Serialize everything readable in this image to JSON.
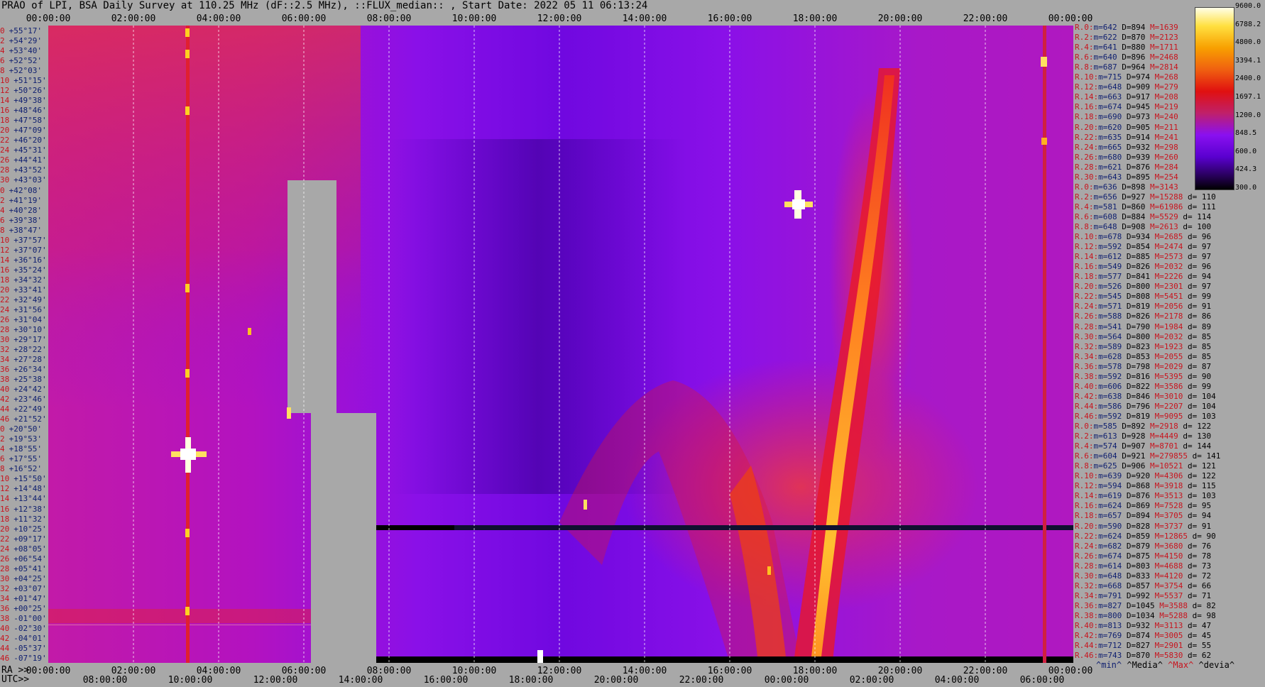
{
  "title": "PRAO of LPI, BSA Daily Survey at 110.25 MHz (dF::2.5 MHz), ::FLUX_median:: , Start Date: 2022 05 11 06:13:24",
  "chart_data": {
    "type": "heatmap",
    "x_ticks_top": [
      "00:00:00",
      "02:00:00",
      "04:00:00",
      "06:00:00",
      "08:00:00",
      "10:00:00",
      "12:00:00",
      "14:00:00",
      "16:00:00",
      "18:00:00",
      "20:00:00",
      "22:00:00",
      "00:00:00"
    ],
    "x_ticks_ra": [
      "00:00:00",
      "02:00:00",
      "04:00:00",
      "06:00:00",
      "08:00:00",
      "10:00:00",
      "12:00:00",
      "14:00:00",
      "16:00:00",
      "18:00:00",
      "20:00:00",
      "22:00:00",
      "00:00:00"
    ],
    "x_ticks_utc": [
      "08:00:00",
      "10:00:00",
      "12:00:00",
      "14:00:00",
      "16:00:00",
      "18:00:00",
      "20:00:00",
      "22:00:00",
      "00:00:00",
      "02:00:00",
      "04:00:00",
      "06:00:00"
    ],
    "ra_prefix": "RA >>",
    "utc_prefix": "UTC>>",
    "y_labels": [
      {
        "beam": "0",
        "dec": "+55°17'"
      },
      {
        "beam": "2",
        "dec": "+54°29'"
      },
      {
        "beam": "4",
        "dec": "+53°40'"
      },
      {
        "beam": "6",
        "dec": "+52°52'"
      },
      {
        "beam": "8",
        "dec": "+52°03'"
      },
      {
        "beam": "10",
        "dec": "+51°15'"
      },
      {
        "beam": "12",
        "dec": "+50°26'"
      },
      {
        "beam": "14",
        "dec": "+49°38'"
      },
      {
        "beam": "16",
        "dec": "+48°46'"
      },
      {
        "beam": "18",
        "dec": "+47°58'"
      },
      {
        "beam": "20",
        "dec": "+47°09'"
      },
      {
        "beam": "22",
        "dec": "+46°20'"
      },
      {
        "beam": "24",
        "dec": "+45°31'"
      },
      {
        "beam": "26",
        "dec": "+44°41'"
      },
      {
        "beam": "28",
        "dec": "+43°52'"
      },
      {
        "beam": "30",
        "dec": "+43°03'"
      },
      {
        "beam": "0",
        "dec": "+42°08'"
      },
      {
        "beam": "2",
        "dec": "+41°19'"
      },
      {
        "beam": "4",
        "dec": "+40°28'"
      },
      {
        "beam": "6",
        "dec": "+39°38'"
      },
      {
        "beam": "8",
        "dec": "+38°47'"
      },
      {
        "beam": "10",
        "dec": "+37°57'"
      },
      {
        "beam": "12",
        "dec": "+37°07'"
      },
      {
        "beam": "14",
        "dec": "+36°16'"
      },
      {
        "beam": "16",
        "dec": "+35°24'"
      },
      {
        "beam": "18",
        "dec": "+34°32'"
      },
      {
        "beam": "20",
        "dec": "+33°41'"
      },
      {
        "beam": "22",
        "dec": "+32°49'"
      },
      {
        "beam": "24",
        "dec": "+31°56'"
      },
      {
        "beam": "26",
        "dec": "+31°04'"
      },
      {
        "beam": "28",
        "dec": "+30°10'"
      },
      {
        "beam": "30",
        "dec": "+29°17'"
      },
      {
        "beam": "32",
        "dec": "+28°22'"
      },
      {
        "beam": "34",
        "dec": "+27°28'"
      },
      {
        "beam": "36",
        "dec": "+26°34'"
      },
      {
        "beam": "38",
        "dec": "+25°38'"
      },
      {
        "beam": "40",
        "dec": "+24°42'"
      },
      {
        "beam": "42",
        "dec": "+23°46'"
      },
      {
        "beam": "44",
        "dec": "+22°49'"
      },
      {
        "beam": "46",
        "dec": "+21°52'"
      },
      {
        "beam": "0",
        "dec": "+20°50'"
      },
      {
        "beam": "2",
        "dec": "+19°53'"
      },
      {
        "beam": "4",
        "dec": "+18°55'"
      },
      {
        "beam": "6",
        "dec": "+17°55'"
      },
      {
        "beam": "8",
        "dec": "+16°52'"
      },
      {
        "beam": "10",
        "dec": "+15°50'"
      },
      {
        "beam": "12",
        "dec": "+14°48'"
      },
      {
        "beam": "14",
        "dec": "+13°44'"
      },
      {
        "beam": "16",
        "dec": "+12°38'"
      },
      {
        "beam": "18",
        "dec": "+11°32'"
      },
      {
        "beam": "20",
        "dec": "+10°25'"
      },
      {
        "beam": "22",
        "dec": "+09°17'"
      },
      {
        "beam": "24",
        "dec": "+08°05'"
      },
      {
        "beam": "26",
        "dec": "+06°54'"
      },
      {
        "beam": "28",
        "dec": "+05°41'"
      },
      {
        "beam": "30",
        "dec": "+04°25'"
      },
      {
        "beam": "32",
        "dec": "+03°07'"
      },
      {
        "beam": "34",
        "dec": "+01°47'"
      },
      {
        "beam": "36",
        "dec": "+00°25'"
      },
      {
        "beam": "38",
        "dec": "-01°00'"
      },
      {
        "beam": "40",
        "dec": "-02°30'"
      },
      {
        "beam": "42",
        "dec": "-04°01'"
      },
      {
        "beam": "44",
        "dec": "-05°37'"
      },
      {
        "beam": "46",
        "dec": "-07°19'"
      }
    ],
    "colorbar": {
      "ticks": [
        "9600.0",
        "6788.2",
        "4800.0",
        "3394.1",
        "2400.0",
        "1697.1",
        "1200.0",
        "848.5",
        "600.0",
        "424.3",
        "300.0"
      ],
      "colors": [
        "#000000",
        "#2a0060",
        "#5a00d0",
        "#8a10f0",
        "#c0206a",
        "#e01010",
        "#f06010",
        "#f8a000",
        "#ffe040",
        "#ffffe8"
      ]
    },
    "stats": [
      {
        "label": "R.0:",
        "min": "642",
        "median": "894",
        "max": "1639",
        "dev": ""
      },
      {
        "label": "R.2:",
        "min": "622",
        "median": "870",
        "max": "2123",
        "dev": ""
      },
      {
        "label": "R.4:",
        "min": "641",
        "median": "880",
        "max": "1711",
        "dev": ""
      },
      {
        "label": "R.6:",
        "min": "640",
        "median": "896",
        "max": "2468",
        "dev": ""
      },
      {
        "label": "R.8:",
        "min": "687",
        "median": "964",
        "max": "2814",
        "dev": ""
      },
      {
        "label": "R.10:",
        "min": "715",
        "median": "974",
        "max": "268",
        "dev": ""
      },
      {
        "label": "R.12:",
        "min": "648",
        "median": "909",
        "max": "279",
        "dev": ""
      },
      {
        "label": "R.14:",
        "min": "663",
        "median": "917",
        "max": "208",
        "dev": ""
      },
      {
        "label": "R.16:",
        "min": "674",
        "median": "945",
        "max": "219",
        "dev": ""
      },
      {
        "label": "R.18:",
        "min": "690",
        "median": "973",
        "max": "240",
        "dev": ""
      },
      {
        "label": "R.20:",
        "min": "620",
        "median": "905",
        "max": "211",
        "dev": ""
      },
      {
        "label": "R.22:",
        "min": "635",
        "median": "914",
        "max": "241",
        "dev": ""
      },
      {
        "label": "R.24:",
        "min": "665",
        "median": "932",
        "max": "298",
        "dev": ""
      },
      {
        "label": "R.26:",
        "min": "680",
        "median": "939",
        "max": "260",
        "dev": ""
      },
      {
        "label": "R.28:",
        "min": "621",
        "median": "876",
        "max": "284",
        "dev": ""
      },
      {
        "label": "R.30:",
        "min": "643",
        "median": "895",
        "max": "254",
        "dev": ""
      },
      {
        "label": "R.0:",
        "min": "636",
        "median": "898",
        "max": "3143",
        "dev": ""
      },
      {
        "label": "R.2:",
        "min": "656",
        "median": "927",
        "max": "15288",
        "dev": "110"
      },
      {
        "label": "R.4:",
        "min": "581",
        "median": "860",
        "max": "61986",
        "dev": "111"
      },
      {
        "label": "R.6:",
        "min": "608",
        "median": "884",
        "max": "5529",
        "dev": "114"
      },
      {
        "label": "R.8:",
        "min": "648",
        "median": "908",
        "max": "2613",
        "dev": "100"
      },
      {
        "label": "R.10:",
        "min": "678",
        "median": "934",
        "max": "2685",
        "dev": "96"
      },
      {
        "label": "R.12:",
        "min": "592",
        "median": "854",
        "max": "2474",
        "dev": "97"
      },
      {
        "label": "R.14:",
        "min": "612",
        "median": "885",
        "max": "2573",
        "dev": "97"
      },
      {
        "label": "R.16:",
        "min": "549",
        "median": "826",
        "max": "2032",
        "dev": "96"
      },
      {
        "label": "R.18:",
        "min": "577",
        "median": "841",
        "max": "2226",
        "dev": "94"
      },
      {
        "label": "R.20:",
        "min": "526",
        "median": "800",
        "max": "2301",
        "dev": "97"
      },
      {
        "label": "R.22:",
        "min": "545",
        "median": "808",
        "max": "5451",
        "dev": "99"
      },
      {
        "label": "R.24:",
        "min": "571",
        "median": "819",
        "max": "2056",
        "dev": "91"
      },
      {
        "label": "R.26:",
        "min": "588",
        "median": "826",
        "max": "2178",
        "dev": "86"
      },
      {
        "label": "R.28:",
        "min": "541",
        "median": "790",
        "max": "1984",
        "dev": "89"
      },
      {
        "label": "R.30:",
        "min": "564",
        "median": "800",
        "max": "2032",
        "dev": "85"
      },
      {
        "label": "R.32:",
        "min": "589",
        "median": "823",
        "max": "1923",
        "dev": "85"
      },
      {
        "label": "R.34:",
        "min": "628",
        "median": "853",
        "max": "2055",
        "dev": "85"
      },
      {
        "label": "R.36:",
        "min": "578",
        "median": "798",
        "max": "2029",
        "dev": "87"
      },
      {
        "label": "R.38:",
        "min": "592",
        "median": "816",
        "max": "5395",
        "dev": "90"
      },
      {
        "label": "R.40:",
        "min": "606",
        "median": "822",
        "max": "3586",
        "dev": "99"
      },
      {
        "label": "R.42:",
        "min": "638",
        "median": "846",
        "max": "3010",
        "dev": "104"
      },
      {
        "label": "R.44:",
        "min": "586",
        "median": "796",
        "max": "2207",
        "dev": "104"
      },
      {
        "label": "R.46:",
        "min": "592",
        "median": "819",
        "max": "9095",
        "dev": "103"
      },
      {
        "label": "R.0:",
        "min": "585",
        "median": "892",
        "max": "2918",
        "dev": "122"
      },
      {
        "label": "R.2:",
        "min": "613",
        "median": "928",
        "max": "4449",
        "dev": "130"
      },
      {
        "label": "R.4:",
        "min": "574",
        "median": "907",
        "max": "8701",
        "dev": "144"
      },
      {
        "label": "R.6:",
        "min": "604",
        "median": "921",
        "max": "279855",
        "dev": "141"
      },
      {
        "label": "R.8:",
        "min": "625",
        "median": "906",
        "max": "10521",
        "dev": "121"
      },
      {
        "label": "R.10:",
        "min": "639",
        "median": "920",
        "max": "4306",
        "dev": "122"
      },
      {
        "label": "R.12:",
        "min": "594",
        "median": "868",
        "max": "3918",
        "dev": "115"
      },
      {
        "label": "R.14:",
        "min": "619",
        "median": "876",
        "max": "3513",
        "dev": "103"
      },
      {
        "label": "R.16:",
        "min": "624",
        "median": "869",
        "max": "7528",
        "dev": "95"
      },
      {
        "label": "R.18:",
        "min": "657",
        "median": "894",
        "max": "3705",
        "dev": "94"
      },
      {
        "label": "R.20:",
        "min": "590",
        "median": "828",
        "max": "3737",
        "dev": "91"
      },
      {
        "label": "R.22:",
        "min": "624",
        "median": "859",
        "max": "12865",
        "dev": "90"
      },
      {
        "label": "R.24:",
        "min": "682",
        "median": "879",
        "max": "3680",
        "dev": "76"
      },
      {
        "label": "R.26:",
        "min": "674",
        "median": "875",
        "max": "4150",
        "dev": "78"
      },
      {
        "label": "R.28:",
        "min": "614",
        "median": "803",
        "max": "4688",
        "dev": "73"
      },
      {
        "label": "R.30:",
        "min": "648",
        "median": "833",
        "max": "4120",
        "dev": "72"
      },
      {
        "label": "R.32:",
        "min": "668",
        "median": "857",
        "max": "3754",
        "dev": "66"
      },
      {
        "label": "R.34:",
        "min": "791",
        "median": "992",
        "max": "5537",
        "dev": "71"
      },
      {
        "label": "R.36:",
        "min": "827",
        "median": "1045",
        "max": "3588",
        "dev": "82"
      },
      {
        "label": "R.38:",
        "min": "800",
        "median": "1034",
        "max": "5288",
        "dev": "98"
      },
      {
        "label": "R.40:",
        "min": "813",
        "median": "932",
        "max": "3113",
        "dev": "47"
      },
      {
        "label": "R.42:",
        "min": "769",
        "median": "874",
        "max": "3005",
        "dev": "45"
      },
      {
        "label": "R.44:",
        "min": "712",
        "median": "827",
        "max": "2901",
        "dev": "55"
      },
      {
        "label": "R.46:",
        "min": "743",
        "median": "870",
        "max": "5830",
        "dev": "62"
      }
    ],
    "footer": {
      "min": "^min^",
      "median": "^Media^",
      "max": "^Max^",
      "dev": "^devia^"
    },
    "grid": true
  }
}
